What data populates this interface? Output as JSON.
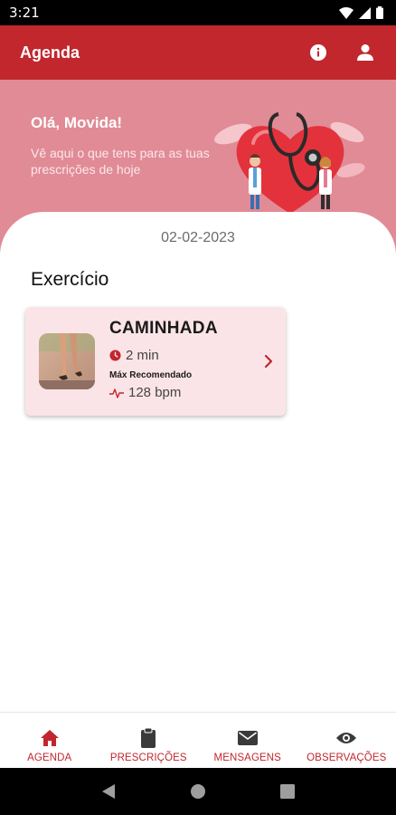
{
  "status_bar": {
    "time": "3:21"
  },
  "app_bar": {
    "title": "Agenda",
    "info_icon": "info-icon",
    "profile_icon": "person-icon"
  },
  "hero": {
    "greeting": "Olá, Movida!",
    "subtitle": "Vê aqui o que tens para as tuas prescrições de hoje"
  },
  "agenda": {
    "date": "02-02-2023",
    "section_title": "Exercício",
    "exercise": {
      "title": "CAMINHADA",
      "duration": "2 min",
      "max_label": "Máx Recomendado",
      "bpm": "128 bpm"
    }
  },
  "bottom_nav": {
    "items": [
      {
        "label": "AGENDA",
        "icon": "home-icon",
        "active": true
      },
      {
        "label": "PRESCRIÇÕES",
        "icon": "clipboard-icon",
        "active": false
      },
      {
        "label": "MENSAGENS",
        "icon": "envelope-icon",
        "active": false
      },
      {
        "label": "OBSERVAÇÕES",
        "icon": "eye-icon",
        "active": false
      }
    ]
  },
  "colors": {
    "primary": "#c1272d",
    "hero": "#e08b96",
    "card": "#fbe4e7"
  }
}
